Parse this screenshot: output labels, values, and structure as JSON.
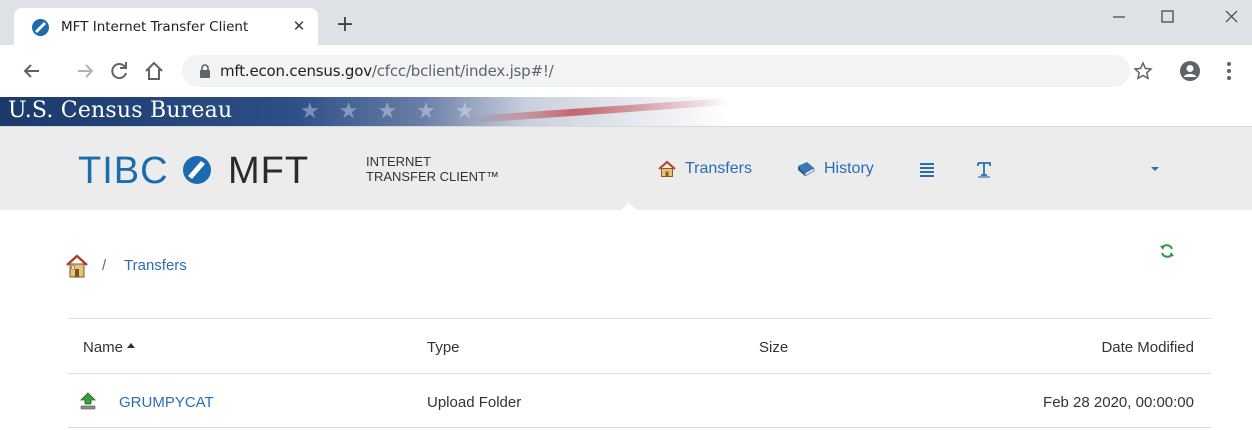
{
  "browser": {
    "tab_title": "MFT Internet Transfer Client",
    "tab_close": "✕",
    "new_tab": "+",
    "window_minimize": "─",
    "window_maximize": "☐",
    "window_close": "✕",
    "url_host": "mft.econ.census.gov",
    "url_path": "/cfcc/bclient/index.jsp#!/"
  },
  "banner": {
    "title": "U.S. Census Bureau"
  },
  "app_header": {
    "logo_tibco": "TIBC",
    "logo_mft": "MFT",
    "logo_sub_line1": "INTERNET",
    "logo_sub_line2": "TRANSFER CLIENT™",
    "nav": {
      "transfers": "Transfers",
      "history": "History"
    }
  },
  "breadcrumb": {
    "separator": "/",
    "current": "Transfers"
  },
  "table": {
    "columns": {
      "name": "Name",
      "type": "Type",
      "size": "Size",
      "date_modified": "Date Modified"
    },
    "rows": [
      {
        "name": "GRUMPYCAT",
        "type": "Upload Folder",
        "size": "",
        "date_modified": "Feb 28 2020, 00:00:00",
        "icon": "upload-icon"
      }
    ],
    "sort_column": "name",
    "sort_direction": "ascending"
  },
  "icons": {
    "favicon": "tibco-favicon",
    "back": "back-arrow-icon",
    "forward": "forward-arrow-icon",
    "reload": "reload-icon",
    "home": "home-icon",
    "lock": "lock-icon",
    "bookmark": "star-icon",
    "profile": "profile-icon",
    "menu": "kebab-menu-icon",
    "refresh": "refresh-icon"
  },
  "colors": {
    "link": "#2a6db3",
    "header_bg": "#ececec",
    "census_blue": "#1b3a6b",
    "tibco_blue": "#1c6aaf",
    "refresh_green": "#2e9b3a"
  }
}
